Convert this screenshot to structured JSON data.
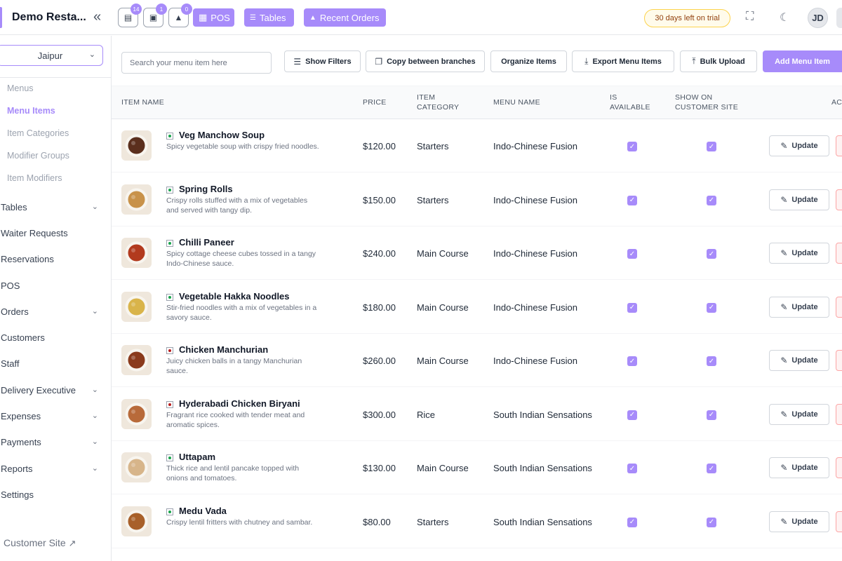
{
  "header": {
    "brand": "Demo Resta...",
    "badges": {
      "orders": "14",
      "reservations": "1",
      "waiter": "0"
    },
    "pos_label": "POS",
    "tables_label": "Tables",
    "recent_orders_label": "Recent Orders",
    "trial_text": "30 days left on trial",
    "avatar_initials": "JD"
  },
  "sidebar": {
    "branch": "Jaipur",
    "sub_items": [
      "Menus",
      "Menu Items",
      "Item Categories",
      "Modifier Groups",
      "Item Modifiers"
    ],
    "nav_items": [
      {
        "label": "Tables",
        "has_chevron": true
      },
      {
        "label": "Waiter Requests",
        "has_chevron": false
      },
      {
        "label": "Reservations",
        "has_chevron": false
      },
      {
        "label": "POS",
        "has_chevron": false
      },
      {
        "label": "Orders",
        "has_chevron": true
      },
      {
        "label": "Customers",
        "has_chevron": false
      },
      {
        "label": "Staff",
        "has_chevron": false
      },
      {
        "label": "Delivery Executive",
        "has_chevron": true
      },
      {
        "label": "Expenses",
        "has_chevron": true
      },
      {
        "label": "Payments",
        "has_chevron": true
      },
      {
        "label": "Reports",
        "has_chevron": true
      },
      {
        "label": "Settings",
        "has_chevron": false
      }
    ],
    "customer_site": "Customer Site"
  },
  "toolbar": {
    "search_placeholder": "Search your menu item here",
    "show_filters": "Show Filters",
    "copy_branches": "Copy between branches",
    "organize": "Organize Items",
    "export": "Export Menu Items",
    "bulk_upload": "Bulk Upload",
    "add_item": "Add Menu Item"
  },
  "table": {
    "headers": {
      "item_name": "ITEM NAME",
      "price": "PRICE",
      "category_1": "ITEM",
      "category_2": "CATEGORY",
      "menu_name": "MENU NAME",
      "available_1": "IS",
      "available_2": "AVAILABLE",
      "show_1": "SHOW ON",
      "show_2": "CUSTOMER SITE",
      "actions": "AC"
    },
    "update_label": "Update",
    "rows": [
      {
        "name": "Veg Manchow Soup",
        "desc": "Spicy vegetable soup with crispy fried noodles.",
        "price": "$120.00",
        "category": "Starters",
        "menu": "Indo-Chinese Fusion",
        "veg": true,
        "available": true,
        "show": true,
        "thumb": "#5b2f1d"
      },
      {
        "name": "Spring Rolls",
        "desc": "Crispy rolls stuffed with a mix of vegetables and served with tangy dip.",
        "price": "$150.00",
        "category": "Starters",
        "menu": "Indo-Chinese Fusion",
        "veg": true,
        "available": true,
        "show": true,
        "thumb": "#c8924a"
      },
      {
        "name": "Chilli Paneer",
        "desc": "Spicy cottage cheese cubes tossed in a tangy Indo-Chinese sauce.",
        "price": "$240.00",
        "category": "Main Course",
        "menu": "Indo-Chinese Fusion",
        "veg": true,
        "available": true,
        "show": true,
        "thumb": "#b23a1e"
      },
      {
        "name": "Vegetable Hakka Noodles",
        "desc": "Stir-fried noodles with a mix of vegetables in a savory sauce.",
        "price": "$180.00",
        "category": "Main Course",
        "menu": "Indo-Chinese Fusion",
        "veg": true,
        "available": true,
        "show": true,
        "thumb": "#d9b44a"
      },
      {
        "name": "Chicken Manchurian",
        "desc": "Juicy chicken balls in a tangy Manchurian sauce.",
        "price": "$260.00",
        "category": "Main Course",
        "menu": "Indo-Chinese Fusion",
        "veg": false,
        "available": true,
        "show": true,
        "thumb": "#8a3a1c"
      },
      {
        "name": "Hyderabadi Chicken Biryani",
        "desc": "Fragrant rice cooked with tender meat and aromatic spices.",
        "price": "$300.00",
        "category": "Rice",
        "menu": "South Indian Sensations",
        "veg": false,
        "available": true,
        "show": true,
        "thumb": "#b86a3a"
      },
      {
        "name": "Uttapam",
        "desc": "Thick rice and lentil pancake topped with onions and tomatoes.",
        "price": "$130.00",
        "category": "Main Course",
        "menu": "South Indian Sensations",
        "veg": true,
        "available": true,
        "show": true,
        "thumb": "#d7b58a"
      },
      {
        "name": "Medu Vada",
        "desc": "Crispy lentil fritters with chutney and sambar.",
        "price": "$80.00",
        "category": "Starters",
        "menu": "South Indian Sensations",
        "veg": true,
        "available": true,
        "show": true,
        "thumb": "#a8602a"
      }
    ]
  },
  "colors": {
    "accent": "#a78bfa",
    "border": "#e5e7eb",
    "veg": "#16a34a",
    "nonveg": "#b91c1c"
  }
}
